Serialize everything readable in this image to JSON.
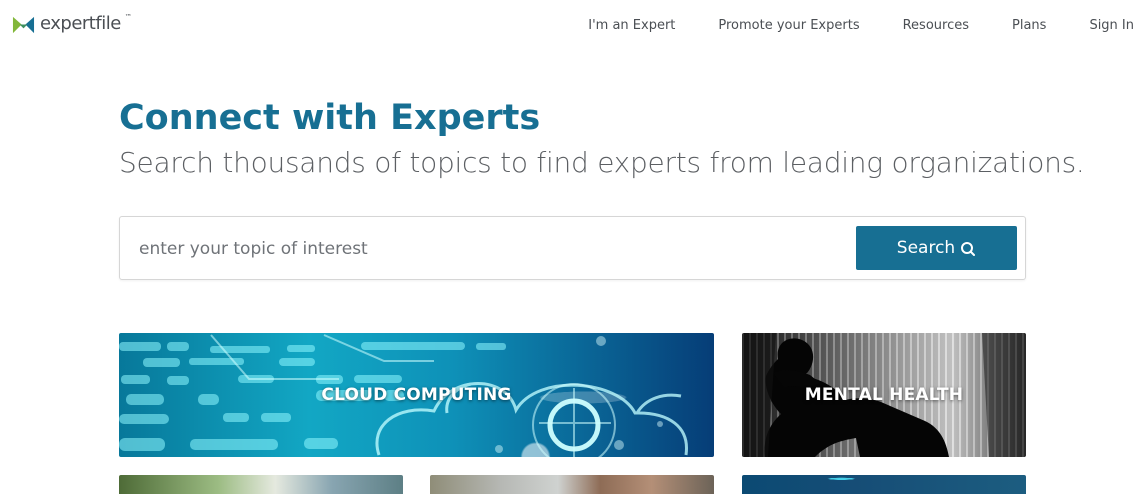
{
  "brand": {
    "name": "expertfile",
    "trademark": "™",
    "colors": {
      "green": "#82b73a",
      "blue": "#176f93",
      "gray": "#4b4f54"
    }
  },
  "nav": {
    "items": [
      {
        "label": "I'm an Expert"
      },
      {
        "label": "Promote your Experts"
      },
      {
        "label": "Resources"
      },
      {
        "label": "Plans"
      },
      {
        "label": "Sign In"
      }
    ]
  },
  "hero": {
    "title": "Connect with Experts",
    "subtitle": "Search thousands of topics to find experts from leading organizations."
  },
  "search": {
    "placeholder": "enter your topic of interest",
    "button_label": "Search",
    "icon": "search-icon"
  },
  "topics": [
    {
      "label": "CLOUD COMPUTING"
    },
    {
      "label": "MENTAL HEALTH"
    }
  ]
}
